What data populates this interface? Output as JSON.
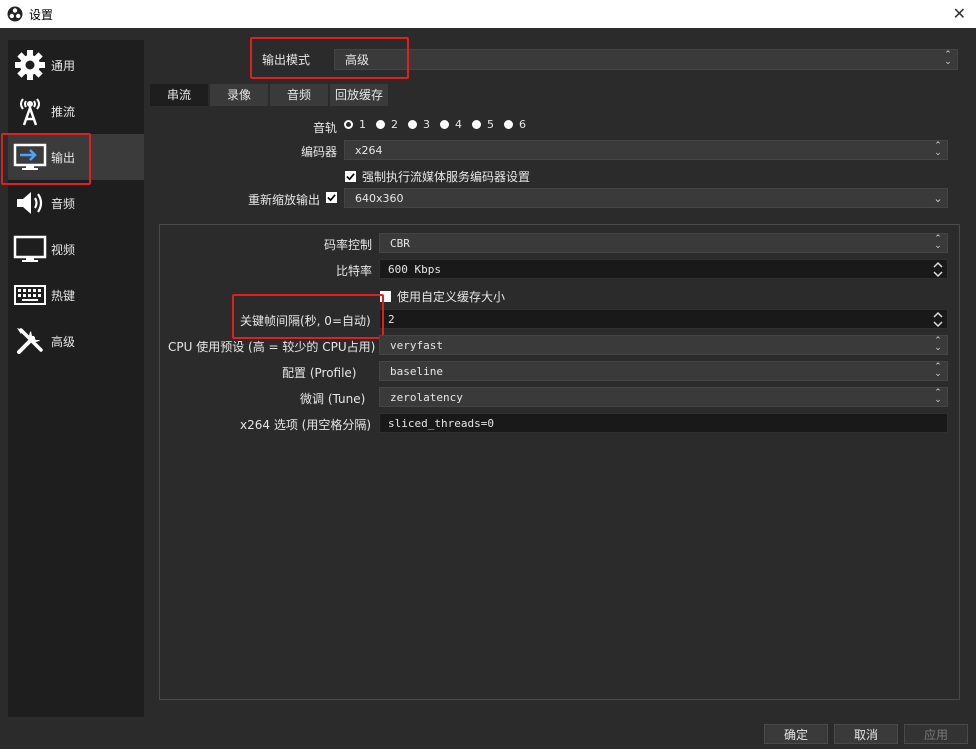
{
  "window": {
    "title": "设置"
  },
  "sidebar": {
    "items": [
      {
        "label": "通用",
        "icon": "gear-icon"
      },
      {
        "label": "推流",
        "icon": "broadcast-tower-icon"
      },
      {
        "label": "输出",
        "icon": "monitor-output-icon",
        "selected": true
      },
      {
        "label": "音频",
        "icon": "speaker-icon"
      },
      {
        "label": "视频",
        "icon": "monitor-icon"
      },
      {
        "label": "热键",
        "icon": "keyboard-icon"
      },
      {
        "label": "高级",
        "icon": "tools-icon"
      }
    ]
  },
  "output_mode": {
    "label": "输出模式",
    "value": "高级"
  },
  "tabs": [
    "串流",
    "录像",
    "音频",
    "回放缓存"
  ],
  "streaming": {
    "audio_track": {
      "label": "音轨",
      "options": [
        "1",
        "2",
        "3",
        "4",
        "5",
        "6"
      ],
      "selected": "1"
    },
    "encoder": {
      "label": "编码器",
      "value": "x264"
    },
    "enforce_service": {
      "label": "强制执行流媒体服务编码器设置",
      "checked": true
    },
    "rescale": {
      "label": "重新缩放输出",
      "checked": true,
      "value": "640x360"
    }
  },
  "encoder_settings": {
    "rate_control": {
      "label": "码率控制",
      "value": "CBR"
    },
    "bitrate": {
      "label": "比特率",
      "value": "600 Kbps"
    },
    "custom_buffer": {
      "label": "使用自定义缓存大小",
      "checked": false
    },
    "keyframe_interval": {
      "label": "关键帧间隔(秒, 0=自动)",
      "value": "2"
    },
    "cpu_preset": {
      "label": "CPU 使用预设 (高 = 较少的 CPU占用)",
      "value": "veryfast"
    },
    "profile": {
      "label": "配置 (Profile)",
      "value": "baseline"
    },
    "tune": {
      "label": "微调 (Tune)",
      "value": "zerolatency"
    },
    "x264_options": {
      "label": "x264 选项 (用空格分隔)",
      "value": "sliced_threads=0"
    }
  },
  "buttons": {
    "ok": "确定",
    "cancel": "取消",
    "apply": "应用"
  },
  "colors": {
    "highlight_box": "#e02020",
    "background": "#2b2b2b",
    "sidebar": "#1e1e1e"
  }
}
